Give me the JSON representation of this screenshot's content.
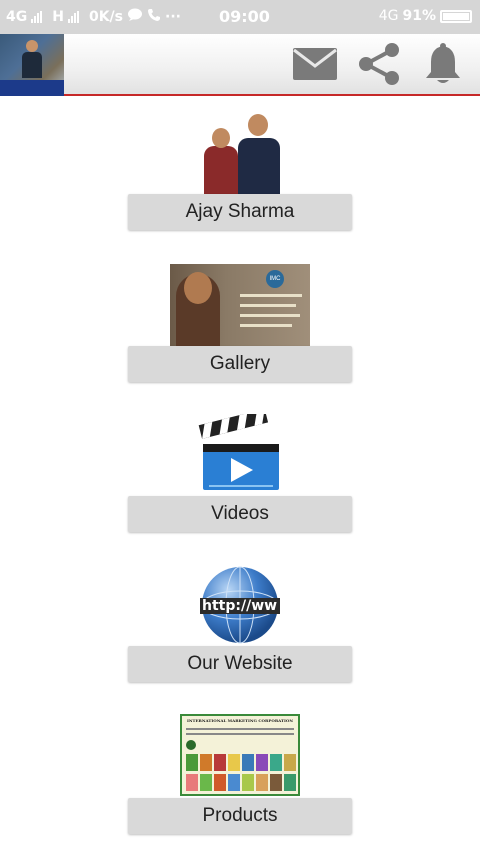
{
  "status_bar": {
    "network_1": "4G",
    "network_2": "H",
    "speed": "0K/s",
    "extra": "···",
    "time": "09:00",
    "network_3": "4G",
    "battery": "91%"
  },
  "header": {
    "icons": [
      "mail-icon",
      "share-icon",
      "bell-icon"
    ]
  },
  "menu": {
    "items": [
      {
        "label": "Ajay Sharma",
        "image": "profile-photo"
      },
      {
        "label": "Gallery",
        "image": "gallery-photo"
      },
      {
        "label": "Videos",
        "image": "video-clapper-icon"
      },
      {
        "label": "Our Website",
        "image": "globe-http-icon"
      },
      {
        "label": "Products",
        "image": "products-poster"
      }
    ],
    "gallery_image_text": "IMC",
    "products_image_text": "INTERNATIONAL MARKETING CORPORATION PVT LTD",
    "website_image_text": "http://ww"
  },
  "colors": {
    "accent_red": "#c62828",
    "button_bg": "#d9d9d9",
    "icon_gray": "#7a7a7a"
  }
}
